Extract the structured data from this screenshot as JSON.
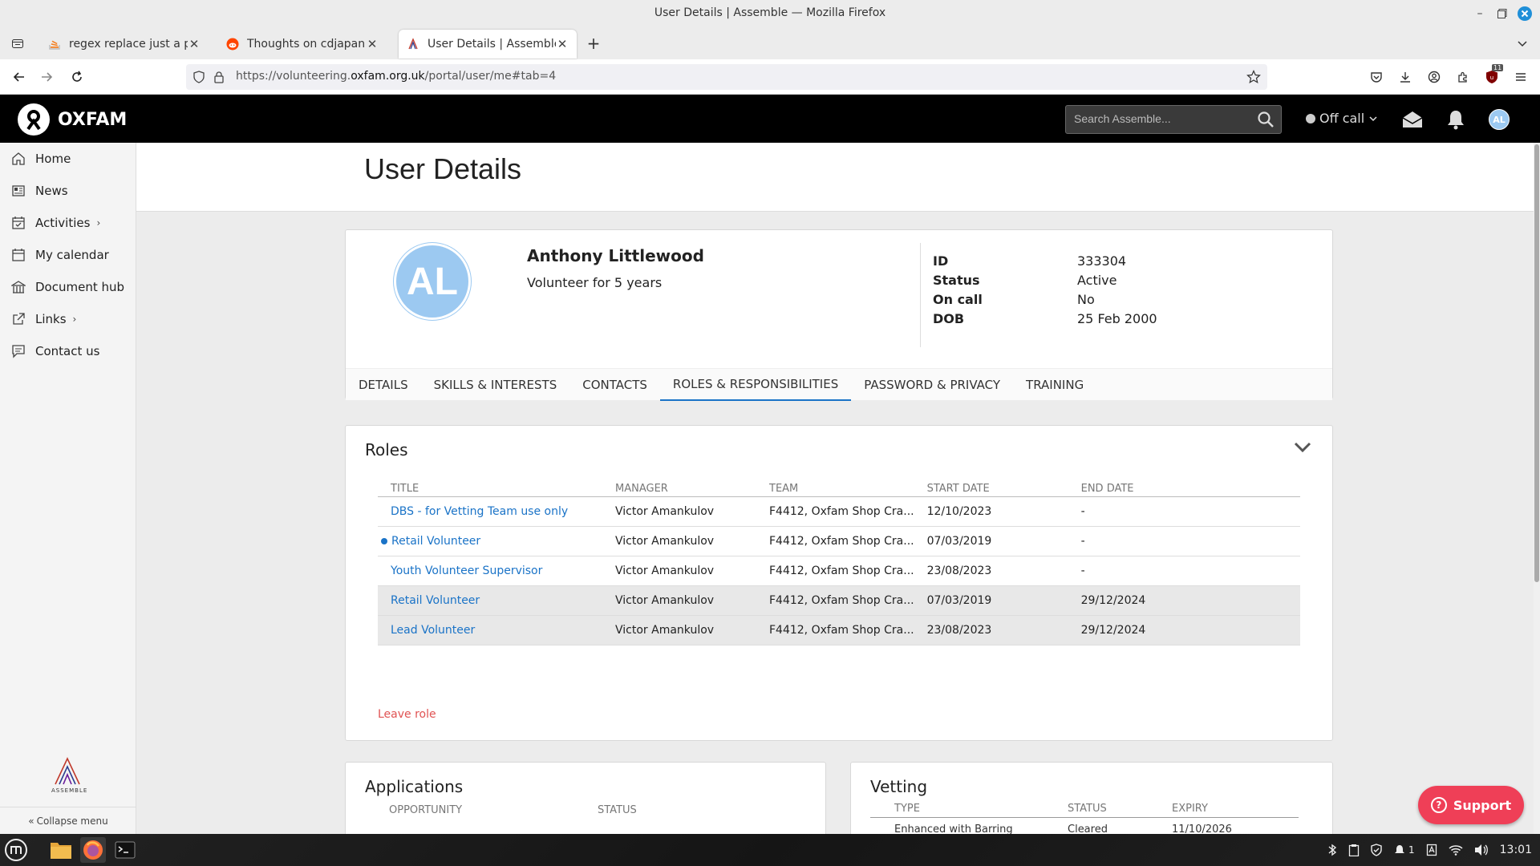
{
  "window": {
    "title": "User Details | Assemble — Mozilla Firefox"
  },
  "browser": {
    "tabs": [
      {
        "label": "regex replace just a part in"
      },
      {
        "label": "Thoughts on cdjapan.com?"
      },
      {
        "label": "User Details | Assemble"
      }
    ],
    "url": {
      "prefix": "https://volunteering.",
      "domain": "oxfam.org.uk",
      "path": "/portal/user/me#tab=4"
    },
    "extension_badge": "11"
  },
  "header": {
    "logo_text": "OXFAM",
    "search_placeholder": "Search Assemble...",
    "call_status": "Off call",
    "avatar_initials": "AL"
  },
  "sidebar": {
    "items": [
      {
        "label": "Home"
      },
      {
        "label": "News"
      },
      {
        "label": "Activities"
      },
      {
        "label": "My calendar"
      },
      {
        "label": "Document hub"
      },
      {
        "label": "Links"
      },
      {
        "label": "Contact us"
      }
    ],
    "collapse_label": "Collapse menu",
    "assemble_label": "ASSEMBLE"
  },
  "page": {
    "title": "User Details"
  },
  "profile": {
    "initials": "AL",
    "name": "Anthony Littlewood",
    "subtitle": "Volunteer for 5 years",
    "fields": [
      {
        "label": "ID",
        "value": "333304"
      },
      {
        "label": "Status",
        "value": "Active"
      },
      {
        "label": "On call",
        "value": "No"
      },
      {
        "label": "DOB",
        "value": "25 Feb 2000"
      }
    ],
    "tabs": [
      {
        "label": "DETAILS"
      },
      {
        "label": "SKILLS & INTERESTS"
      },
      {
        "label": "CONTACTS"
      },
      {
        "label": "ROLES & RESPONSIBILITIES"
      },
      {
        "label": "PASSWORD & PRIVACY"
      },
      {
        "label": "TRAINING"
      }
    ],
    "active_tab": "ROLES & RESPONSIBILITIES"
  },
  "roles": {
    "title": "Roles",
    "columns": [
      "TITLE",
      "MANAGER",
      "TEAM",
      "START DATE",
      "END DATE"
    ],
    "rows": [
      {
        "title": "DBS - for Vetting Team use only",
        "manager": "Victor Amankulov",
        "team": "F4412, Oxfam Shop Cra...",
        "start": "12/10/2023",
        "end": "-"
      },
      {
        "title": "Retail Volunteer",
        "manager": "Victor Amankulov",
        "team": "F4412, Oxfam Shop Cra...",
        "start": "07/03/2019",
        "end": "-"
      },
      {
        "title": "Youth Volunteer Supervisor",
        "manager": "Victor Amankulov",
        "team": "F4412, Oxfam Shop Cra...",
        "start": "23/08/2023",
        "end": "-"
      },
      {
        "title": "Retail Volunteer",
        "manager": "Victor Amankulov",
        "team": "F4412, Oxfam Shop Cra...",
        "start": "07/03/2019",
        "end": "29/12/2024"
      },
      {
        "title": "Lead Volunteer",
        "manager": "Victor Amankulov",
        "team": "F4412, Oxfam Shop Cra...",
        "start": "23/08/2023",
        "end": "29/12/2024"
      }
    ],
    "leave_label": "Leave role"
  },
  "applications": {
    "title": "Applications",
    "columns": [
      "OPPORTUNITY",
      "STATUS"
    ]
  },
  "vetting": {
    "title": "Vetting",
    "columns": [
      "TYPE",
      "STATUS",
      "EXPIRY"
    ],
    "row": {
      "type": "Enhanced with Barring",
      "status": "Cleared",
      "expiry": "11/10/2026"
    }
  },
  "support": {
    "label": "Support"
  },
  "taskbar": {
    "clock": "13:01",
    "notif_count": "1"
  },
  "colors": {
    "accent": "#1a73c7",
    "danger": "#e05353",
    "support": "#ef3f57",
    "avatar": "#9cc9f1"
  }
}
